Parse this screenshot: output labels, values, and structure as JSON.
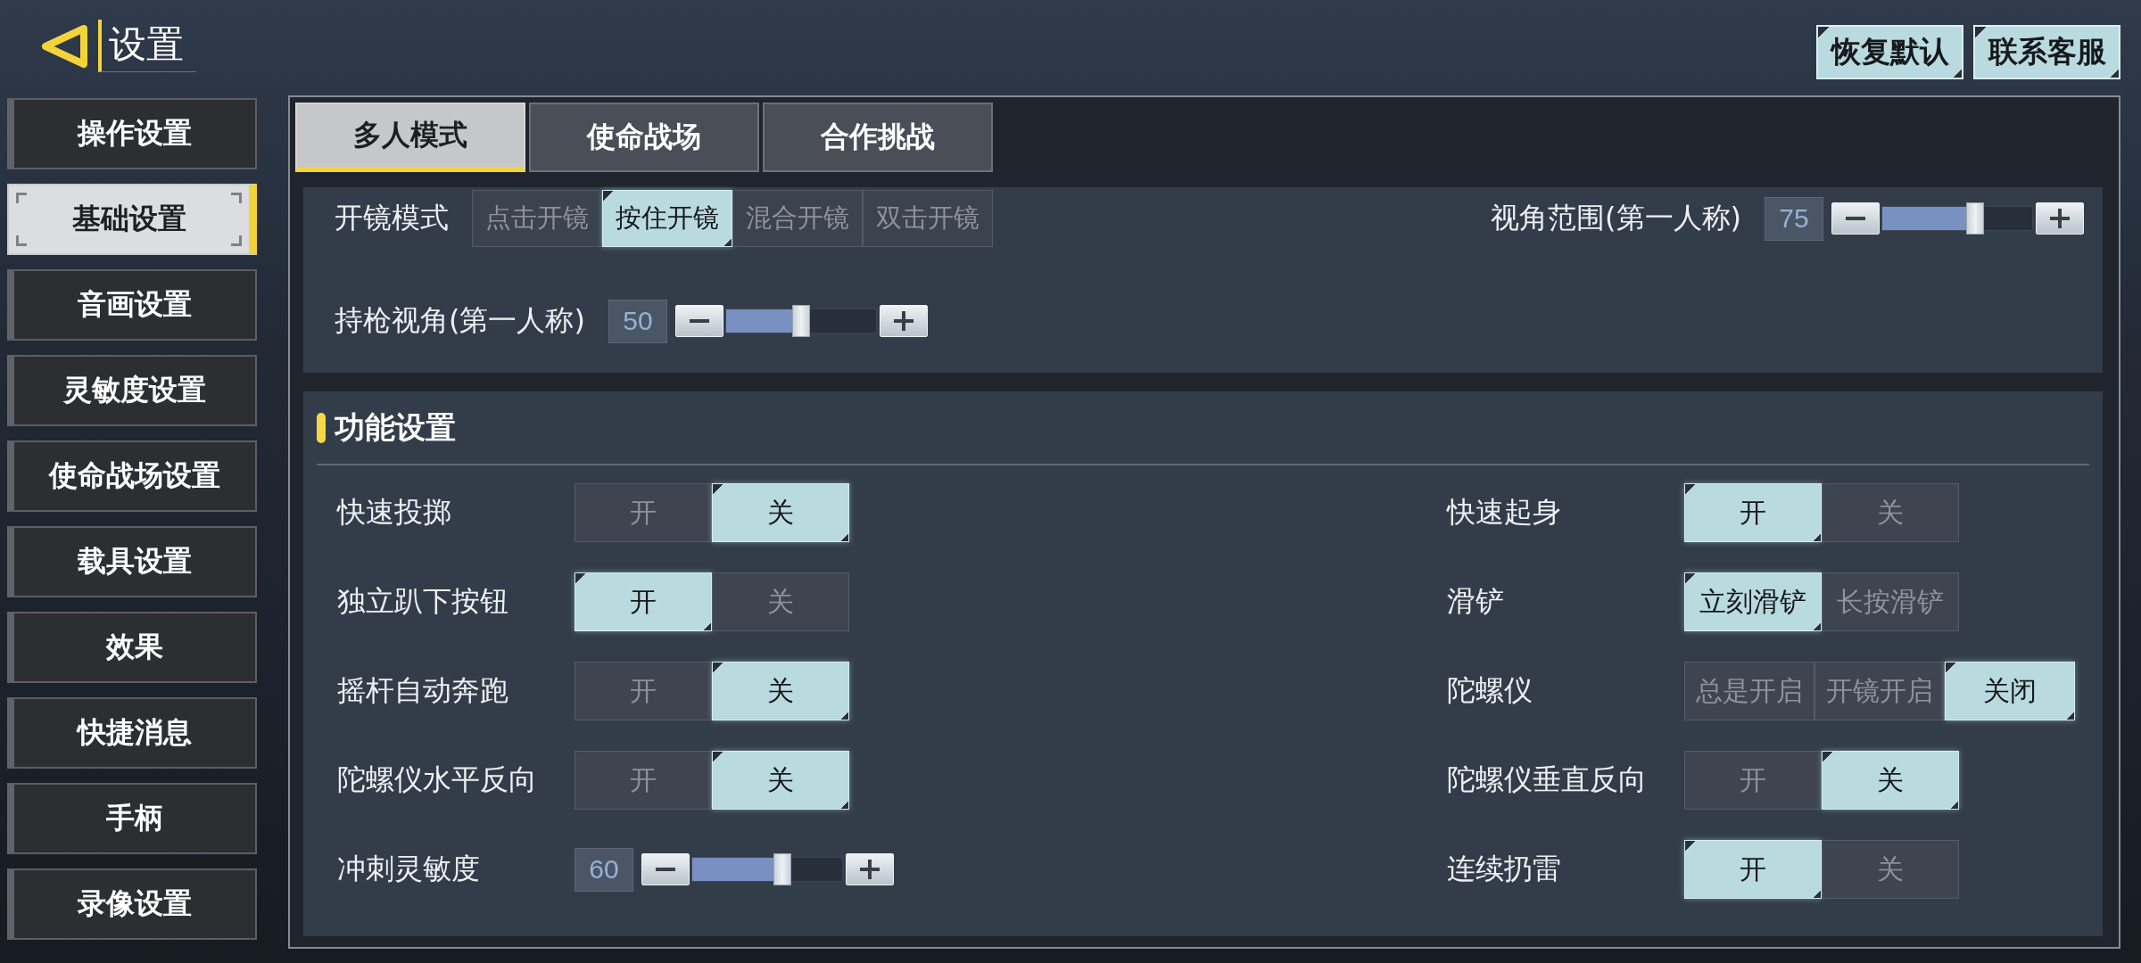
{
  "header": {
    "title": "设置",
    "buttons": [
      {
        "label": "恢复默认"
      },
      {
        "label": "联系客服"
      }
    ]
  },
  "sidebar": {
    "items": [
      {
        "label": "操作设置",
        "selected": false
      },
      {
        "label": "基础设置",
        "selected": true
      },
      {
        "label": "音画设置",
        "selected": false
      },
      {
        "label": "灵敏度设置",
        "selected": false
      },
      {
        "label": "使命战场设置",
        "selected": false
      },
      {
        "label": "载具设置",
        "selected": false
      },
      {
        "label": "效果",
        "selected": false
      },
      {
        "label": "快捷消息",
        "selected": false
      },
      {
        "label": "手柄",
        "selected": false
      },
      {
        "label": "录像设置",
        "selected": false
      }
    ]
  },
  "tabs": [
    {
      "label": "多人模式",
      "selected": true
    },
    {
      "label": "使命战场",
      "selected": false
    },
    {
      "label": "合作挑战",
      "selected": false
    }
  ],
  "view_section": {
    "items": [
      {
        "kind": "segmented",
        "label": "开镜模式",
        "options": [
          {
            "label": "点击开镜",
            "selected": false
          },
          {
            "label": "按住开镜",
            "selected": true
          },
          {
            "label": "混合开镜",
            "selected": false
          },
          {
            "label": "双击开镜",
            "selected": false
          }
        ]
      },
      {
        "kind": "slider",
        "label": "视角范围(第一人称)",
        "value": "75",
        "level": 0.62
      },
      {
        "kind": "slider",
        "label": "持枪视角(第一人称)",
        "value": "50",
        "level": 0.5
      }
    ]
  },
  "function_section": {
    "title": "功能设置",
    "left_column": [
      {
        "kind": "segmented",
        "label": "快速投掷",
        "options": [
          {
            "label": "开",
            "selected": false
          },
          {
            "label": "关",
            "selected": true
          }
        ]
      },
      {
        "kind": "segmented",
        "label": "独立趴下按钮",
        "options": [
          {
            "label": "开",
            "selected": true
          },
          {
            "label": "关",
            "selected": false
          }
        ]
      },
      {
        "kind": "segmented",
        "label": "摇杆自动奔跑",
        "options": [
          {
            "label": "开",
            "selected": false
          },
          {
            "label": "关",
            "selected": true
          }
        ]
      },
      {
        "kind": "segmented",
        "label": "陀螺仪水平反向",
        "options": [
          {
            "label": "开",
            "selected": false
          },
          {
            "label": "关",
            "selected": true
          }
        ]
      },
      {
        "kind": "slider",
        "label": "冲刺灵敏度",
        "value": "60",
        "level": 0.6
      }
    ],
    "right_column": [
      {
        "kind": "segmented",
        "label": "快速起身",
        "options": [
          {
            "label": "开",
            "selected": true
          },
          {
            "label": "关",
            "selected": false
          }
        ]
      },
      {
        "kind": "segmented",
        "label": "滑铲",
        "options": [
          {
            "label": "立刻滑铲",
            "selected": true
          },
          {
            "label": "长按滑铲",
            "selected": false
          }
        ]
      },
      {
        "kind": "segmented",
        "label": "陀螺仪",
        "options": [
          {
            "label": "总是开启",
            "selected": false
          },
          {
            "label": "开镜开启",
            "selected": false
          },
          {
            "label": "关闭",
            "selected": true
          }
        ]
      },
      {
        "kind": "segmented",
        "label": "陀螺仪垂直反向",
        "options": [
          {
            "label": "开",
            "selected": false
          },
          {
            "label": "关",
            "selected": true
          }
        ]
      },
      {
        "kind": "segmented",
        "label": "连续扔雷",
        "options": [
          {
            "label": "开",
            "selected": true
          },
          {
            "label": "关",
            "selected": false
          }
        ]
      }
    ]
  }
}
